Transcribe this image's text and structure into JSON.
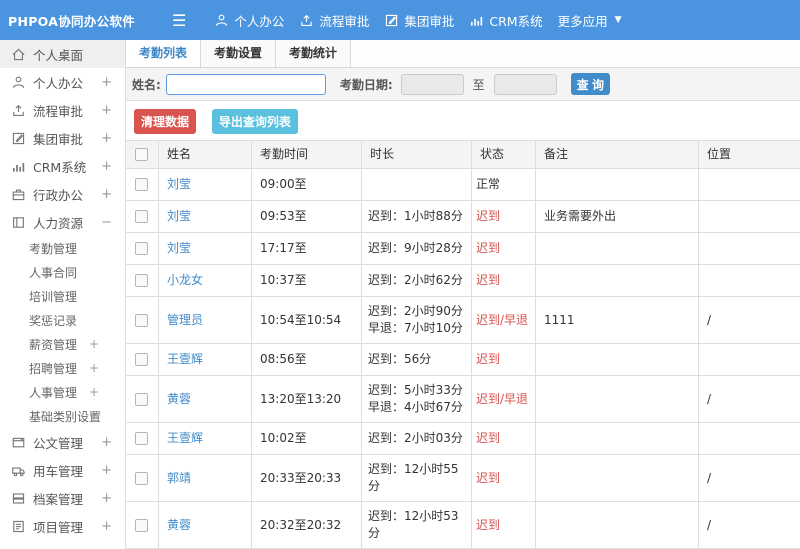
{
  "navbar": {
    "logo": "PHPOA协同办公软件",
    "items": [
      {
        "label": "个人办公",
        "icon": "user-icon"
      },
      {
        "label": "流程审批",
        "icon": "flow-icon"
      },
      {
        "label": "集团审批",
        "icon": "edit-icon"
      },
      {
        "label": "CRM系统",
        "icon": "chart-icon"
      },
      {
        "label": "更多应用",
        "icon": "",
        "caret": true
      }
    ]
  },
  "sidebar": {
    "items": [
      {
        "label": "个人桌面",
        "icon": "home-icon",
        "type": "main",
        "active": true,
        "expand": ""
      },
      {
        "label": "个人办公",
        "icon": "user-icon",
        "type": "main",
        "expand": "+"
      },
      {
        "label": "流程审批",
        "icon": "flow-icon",
        "type": "main",
        "expand": "+"
      },
      {
        "label": "集团审批",
        "icon": "edit-icon",
        "type": "main",
        "expand": "+"
      },
      {
        "label": "CRM系统",
        "icon": "chart-icon",
        "type": "main",
        "expand": "+"
      },
      {
        "label": "行政办公",
        "icon": "briefcase-icon",
        "type": "main",
        "expand": "+"
      },
      {
        "label": "人力资源",
        "icon": "book-icon",
        "type": "main",
        "expand": "−"
      },
      {
        "label": "考勤管理",
        "type": "sub",
        "expand": ""
      },
      {
        "label": "人事合同",
        "type": "sub",
        "expand": ""
      },
      {
        "label": "培训管理",
        "type": "sub",
        "expand": ""
      },
      {
        "label": "奖惩记录",
        "type": "sub",
        "expand": ""
      },
      {
        "label": "薪资管理",
        "type": "sub",
        "expand": "+"
      },
      {
        "label": "招聘管理",
        "type": "sub",
        "expand": "+"
      },
      {
        "label": "人事管理",
        "type": "sub",
        "expand": "+"
      },
      {
        "label": "基础类别设置",
        "type": "sub",
        "expand": "+"
      },
      {
        "label": "公文管理",
        "icon": "doc-icon",
        "type": "main",
        "expand": "+"
      },
      {
        "label": "用车管理",
        "icon": "truck-icon",
        "type": "main",
        "expand": "+"
      },
      {
        "label": "档案管理",
        "icon": "archive-icon",
        "type": "main",
        "expand": "+"
      },
      {
        "label": "项目管理",
        "icon": "project-icon",
        "type": "main",
        "expand": "+"
      }
    ]
  },
  "tabs": [
    {
      "label": "考勤列表",
      "active": true
    },
    {
      "label": "考勤设置",
      "active": false
    },
    {
      "label": "考勤统计",
      "active": false
    }
  ],
  "search": {
    "name_label": "姓名:",
    "name_value": "",
    "date_label": "考勤日期:",
    "date_from": "",
    "to_label": "至",
    "date_to": "",
    "query_label": "查 询"
  },
  "actions": {
    "clean_label": "清理数据",
    "export_label": "导出查询列表"
  },
  "table": {
    "columns": [
      "姓名",
      "考勤时间",
      "时长",
      "状态",
      "备注",
      "位置"
    ],
    "rows": [
      {
        "name": "刘莹",
        "time": "09:00至",
        "duration": [],
        "status": "正常",
        "status_type": "normal",
        "note": "",
        "location": ""
      },
      {
        "name": "刘莹",
        "time": "09:53至",
        "duration": [
          "迟到：1小时88分"
        ],
        "status": "迟到",
        "status_type": "late",
        "note": "业务需要外出",
        "location": ""
      },
      {
        "name": "刘莹",
        "time": "17:17至",
        "duration": [
          "迟到：9小时28分"
        ],
        "status": "迟到",
        "status_type": "late",
        "note": "",
        "location": ""
      },
      {
        "name": "小龙女",
        "time": "10:37至",
        "duration": [
          "迟到：2小时62分"
        ],
        "status": "迟到",
        "status_type": "late",
        "note": "",
        "location": ""
      },
      {
        "name": "管理员",
        "time": "10:54至10:54",
        "duration": [
          "迟到：2小时90分",
          "早退：7小时10分"
        ],
        "status": "迟到/早退",
        "status_type": "late",
        "note": "1111",
        "location": "/"
      },
      {
        "name": "王壹辉",
        "time": "08:56至",
        "duration": [
          "迟到：56分"
        ],
        "status": "迟到",
        "status_type": "late",
        "note": "",
        "location": ""
      },
      {
        "name": "黄蓉",
        "time": "13:20至13:20",
        "duration": [
          "迟到：5小时33分",
          "早退：4小时67分"
        ],
        "status": "迟到/早退",
        "status_type": "late",
        "note": "",
        "location": "/"
      },
      {
        "name": "王壹辉",
        "time": "10:02至",
        "duration": [
          "迟到：2小时03分"
        ],
        "status": "迟到",
        "status_type": "late",
        "note": "",
        "location": ""
      },
      {
        "name": "郭靖",
        "time": "20:33至20:33",
        "duration": [
          "迟到：12小时55分"
        ],
        "status": "迟到",
        "status_type": "late",
        "note": "",
        "location": "/"
      },
      {
        "name": "黄蓉",
        "time": "20:32至20:32",
        "duration": [
          "迟到：12小时53分"
        ],
        "status": "迟到",
        "status_type": "late",
        "note": "",
        "location": "/"
      }
    ]
  },
  "colors": {
    "navbar_bg": "#4b95e0",
    "accent_blue": "#428bca",
    "danger_red": "#d9534f",
    "info_teal": "#5bc0de",
    "late_red": "#d9534f"
  }
}
